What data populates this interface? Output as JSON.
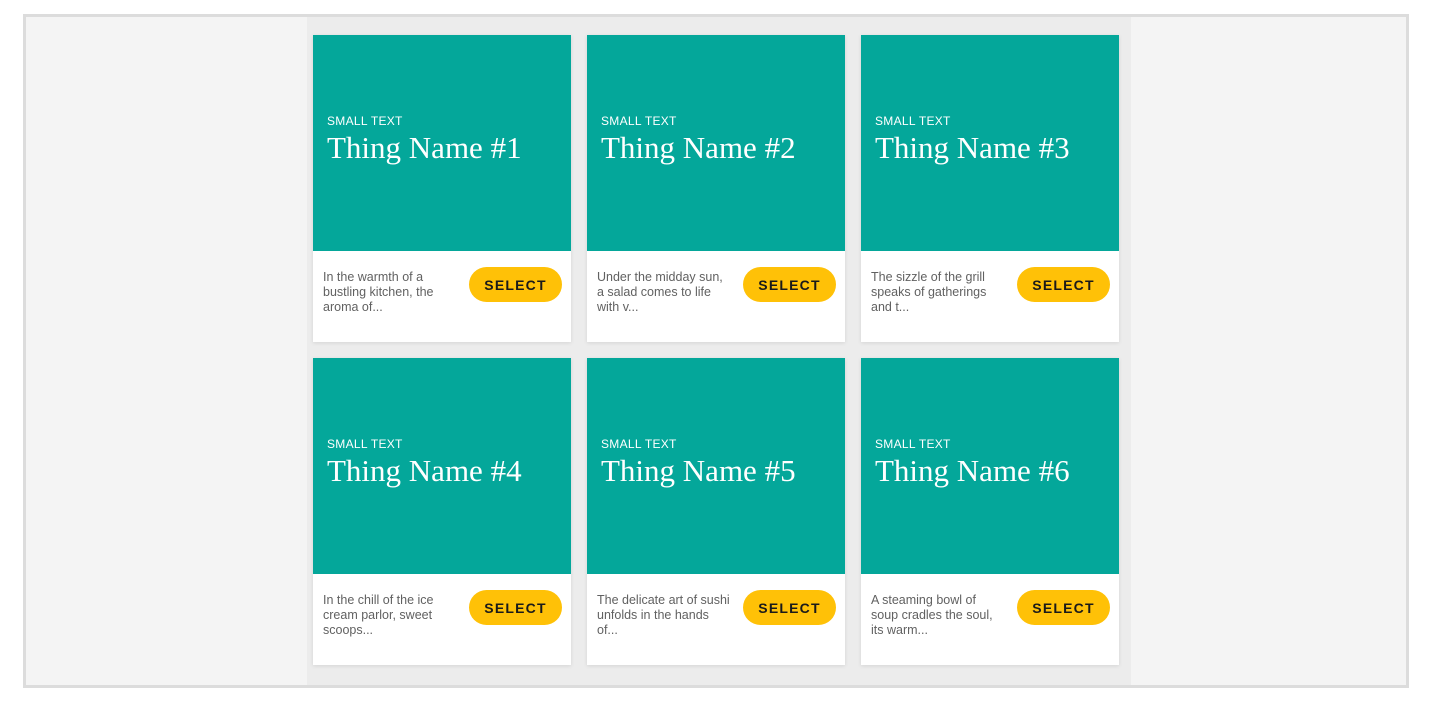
{
  "cards": [
    {
      "eyebrow": "SMALL TEXT",
      "title": "Thing Name #1",
      "description": "In the warmth of a bustling kitchen, the aroma of...",
      "button_label": "SELECT"
    },
    {
      "eyebrow": "SMALL TEXT",
      "title": "Thing Name #2",
      "description": "Under the midday sun, a salad comes to life with v...",
      "button_label": "SELECT"
    },
    {
      "eyebrow": "SMALL TEXT",
      "title": "Thing Name #3",
      "description": "The sizzle of the grill speaks of gatherings and t...",
      "button_label": "SELECT"
    },
    {
      "eyebrow": "SMALL TEXT",
      "title": "Thing Name #4",
      "description": "In the chill of the ice cream parlor, sweet scoops...",
      "button_label": "SELECT"
    },
    {
      "eyebrow": "SMALL TEXT",
      "title": "Thing Name #5",
      "description": "The delicate art of sushi unfolds in the hands of...",
      "button_label": "SELECT"
    },
    {
      "eyebrow": "SMALL TEXT",
      "title": "Thing Name #6",
      "description": "A steaming bowl of soup cradles the soul, its warm...",
      "button_label": "SELECT"
    }
  ],
  "colors": {
    "hero": "#04a79a",
    "button": "#ffc107",
    "background": "#f4f4f4"
  }
}
